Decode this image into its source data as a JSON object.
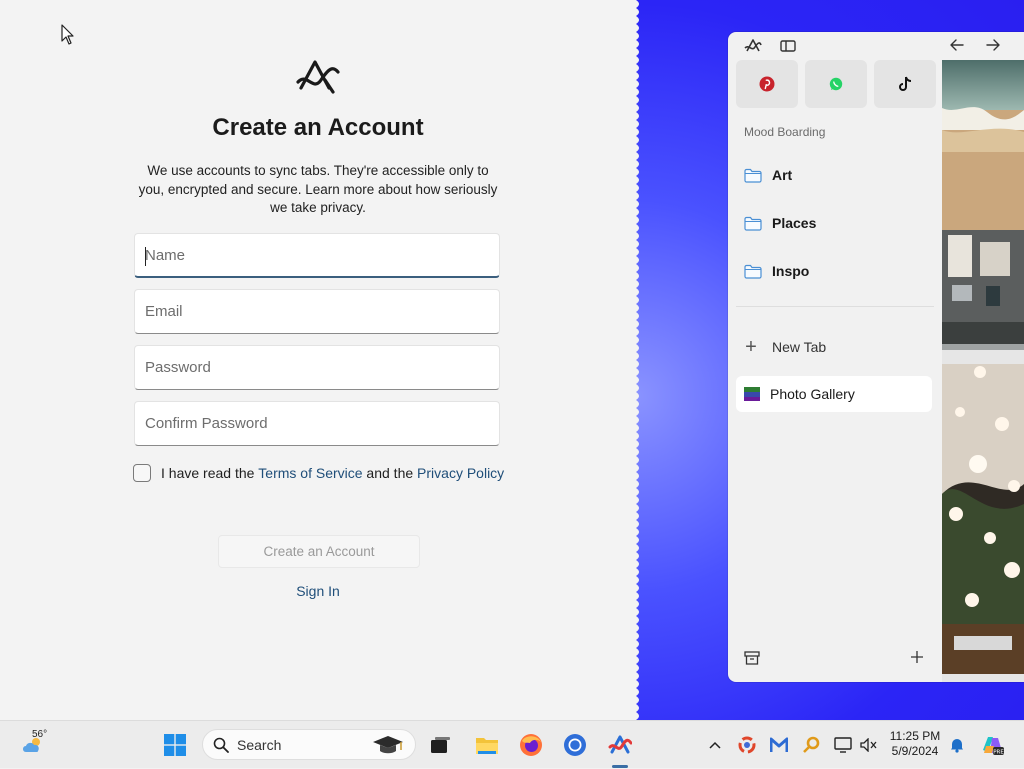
{
  "signup": {
    "title": "Create an Account",
    "description": "We use accounts to sync tabs. They're accessible only to you, encrypted and secure. Learn more about how seriously we take privacy.",
    "fields": {
      "name_placeholder": "Name",
      "email_placeholder": "Email",
      "password_placeholder": "Password",
      "confirm_placeholder": "Confirm Password"
    },
    "agree_prefix": "I have read the ",
    "terms_link": "Terms of Service",
    "agree_middle": " and the ",
    "privacy_link": "Privacy Policy",
    "create_button": "Create an Account",
    "sign_in": "Sign In"
  },
  "browser": {
    "favorites": [
      "pinterest-icon",
      "whatsapp-icon",
      "tiktok-icon"
    ],
    "section_label": "Mood Boarding",
    "folders": [
      "Art",
      "Places",
      "Inspo"
    ],
    "new_tab": "New Tab",
    "active_tab": "Photo Gallery"
  },
  "taskbar": {
    "weather_temp": "56°",
    "search_label": "Search",
    "time": "11:25 PM",
    "date": "5/9/2024"
  },
  "colors": {
    "accent": "#3b5f7e",
    "link": "#1f4e79",
    "background_blue": "#2b25f6"
  }
}
